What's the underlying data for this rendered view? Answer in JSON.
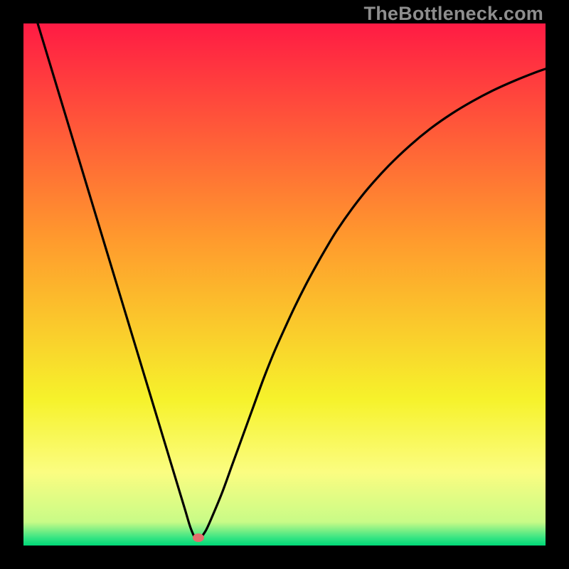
{
  "watermark": "TheBottleneck.com",
  "chart_data": {
    "type": "line",
    "title": "",
    "xlabel": "",
    "ylabel": "",
    "xlim": [
      0,
      100
    ],
    "ylim": [
      0,
      100
    ],
    "grid": false,
    "background_gradient": {
      "stops": [
        {
          "offset": 0.0,
          "color": "#ff1b44"
        },
        {
          "offset": 0.42,
          "color": "#ff9c2d"
        },
        {
          "offset": 0.72,
          "color": "#f6f22b"
        },
        {
          "offset": 0.86,
          "color": "#fbfd81"
        },
        {
          "offset": 0.955,
          "color": "#c8fb87"
        },
        {
          "offset": 0.985,
          "color": "#37e583"
        },
        {
          "offset": 1.0,
          "color": "#00d878"
        }
      ]
    },
    "minimum_marker": {
      "x": 33.5,
      "y": 1.5,
      "color": "#e36f6d"
    },
    "series": [
      {
        "name": "bottleneck-curve",
        "color": "#000000",
        "x": [
          0,
          2,
          4,
          6,
          8,
          10,
          12,
          14,
          16,
          18,
          20,
          22,
          24,
          26,
          28,
          30,
          31,
          32,
          33,
          33.5,
          34,
          35,
          36,
          38,
          40,
          42,
          44,
          46,
          48,
          50,
          52,
          54,
          56,
          58,
          60,
          63,
          66,
          70,
          74,
          78,
          82,
          86,
          90,
          94,
          98,
          100
        ],
        "y": [
          109,
          102.4,
          95.8,
          89.2,
          82.6,
          76,
          69.4,
          62.8,
          56.2,
          49.6,
          43,
          36.4,
          29.8,
          23.2,
          16.6,
          10,
          6.7,
          3.4,
          1.2,
          1,
          1.5,
          3,
          5.2,
          10,
          15.5,
          21,
          26.5,
          32,
          37,
          41.5,
          45.8,
          49.8,
          53.5,
          57,
          60.3,
          64.6,
          68.4,
          72.8,
          76.6,
          79.9,
          82.7,
          85.1,
          87.2,
          89,
          90.6,
          91.3
        ]
      }
    ]
  }
}
